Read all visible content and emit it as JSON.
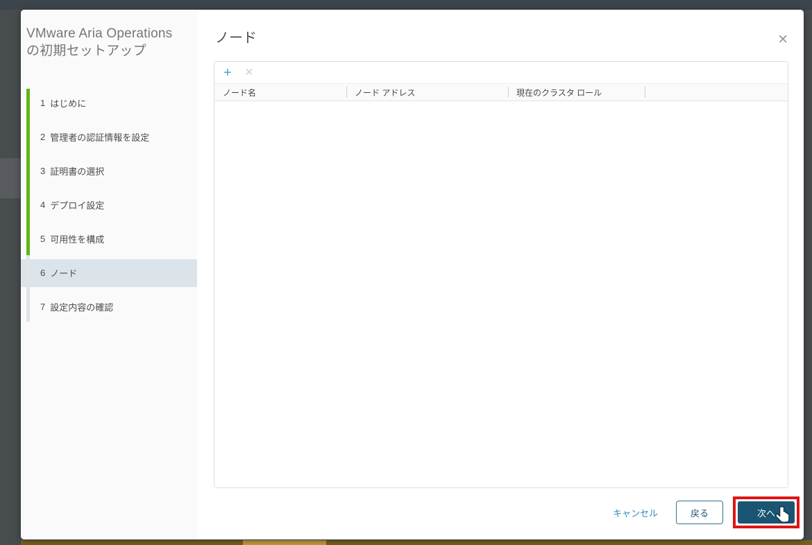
{
  "wizard": {
    "title": "VMware Aria Operations の初期セットアップ",
    "steps": [
      {
        "number": "1",
        "label": "はじめに"
      },
      {
        "number": "2",
        "label": "管理者の認証情報を設定"
      },
      {
        "number": "3",
        "label": "証明書の選択"
      },
      {
        "number": "4",
        "label": "デプロイ設定"
      },
      {
        "number": "5",
        "label": "可用性を構成"
      },
      {
        "number": "6",
        "label": "ノード"
      },
      {
        "number": "7",
        "label": "設定内容の確認"
      }
    ],
    "active_step": "6"
  },
  "main": {
    "title": "ノード",
    "close_icon": "✕",
    "toolbar": {
      "add_icon": "+",
      "delete_icon": "✕"
    },
    "table": {
      "columns": [
        "ノード名",
        "ノード アドレス",
        "現在のクラスタ ロール",
        ""
      ],
      "rows": []
    }
  },
  "footer": {
    "cancel_label": "キャンセル",
    "back_label": "戻る",
    "next_label": "次へ"
  },
  "annotation": {
    "highlight_color": "#E01414",
    "target": "next-button",
    "cursor": "hand-pointer"
  },
  "colors": {
    "accent_green": "#62B515",
    "active_step_bg": "#DCE4EB",
    "primary_button": "#1A5573",
    "link_blue": "#2D8DBC",
    "add_icon_blue": "#4AA3D1",
    "background_bottom_gold": "#C29B3E"
  }
}
